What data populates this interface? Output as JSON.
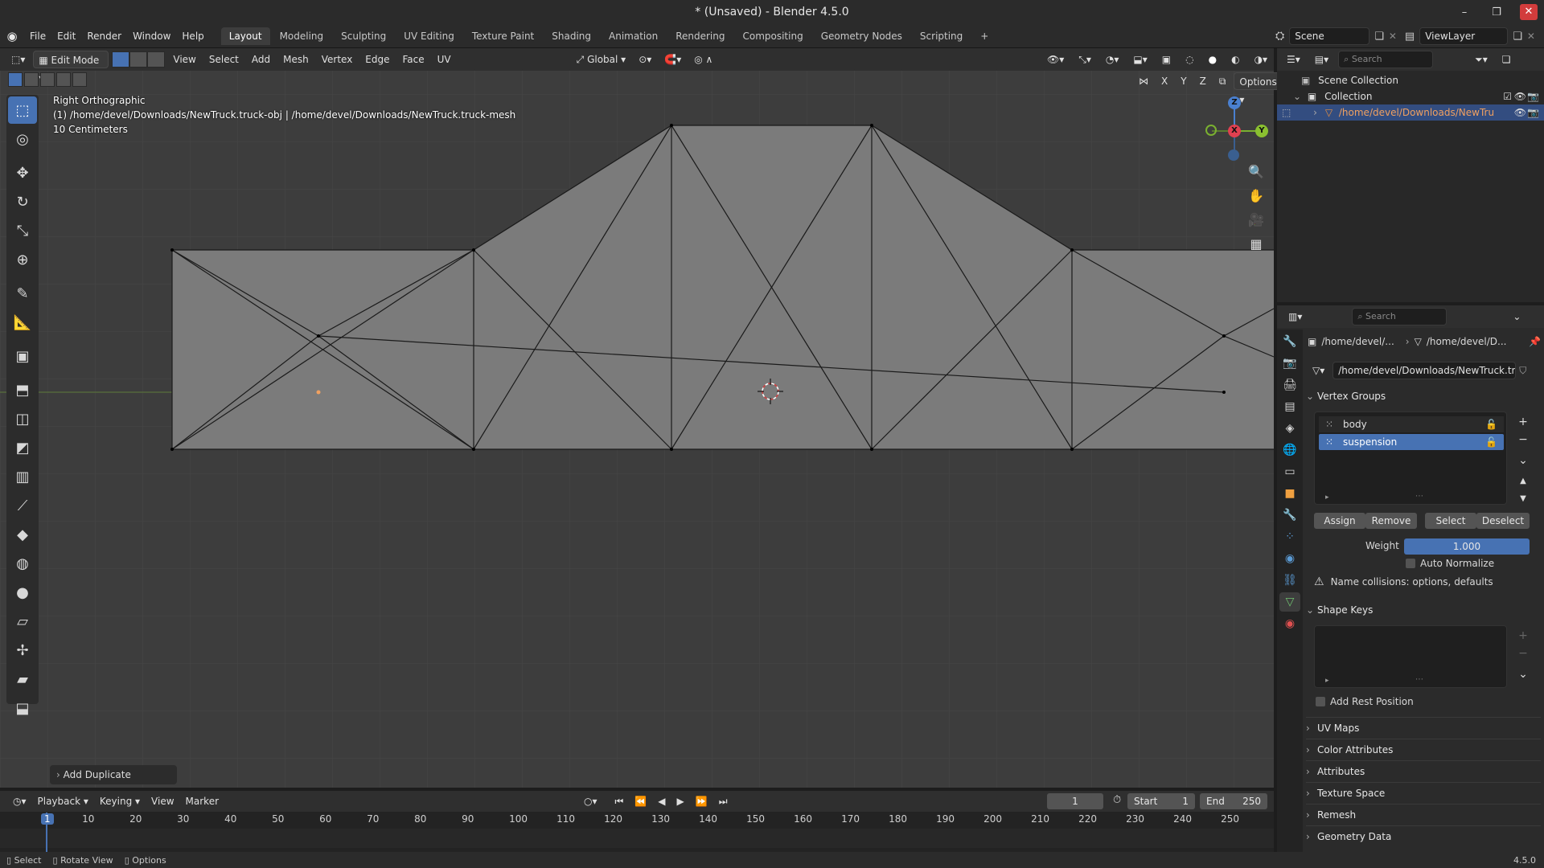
{
  "window": {
    "title": "* (Unsaved) - Blender 4.5.0",
    "buttons": [
      "–",
      "❐",
      "✕"
    ]
  },
  "menubar": {
    "items": [
      "File",
      "Edit",
      "Render",
      "Window",
      "Help"
    ],
    "workspaces": [
      "Layout",
      "Modeling",
      "Sculpting",
      "UV Editing",
      "Texture Paint",
      "Shading",
      "Animation",
      "Rendering",
      "Compositing",
      "Geometry Nodes",
      "Scripting"
    ],
    "active_workspace": "Layout",
    "add_tab": "+",
    "scene": "Scene",
    "view_layer": "ViewLayer"
  },
  "viewport_header": {
    "mode": "Edit Mode",
    "menus": [
      "View",
      "Select",
      "Add",
      "Mesh",
      "Vertex",
      "Edge",
      "Face",
      "UV"
    ],
    "orientation": "Global",
    "axes": [
      "X",
      "Y",
      "Z"
    ],
    "options": "Options"
  },
  "viewport_info": {
    "view_name": "Right Orthographic",
    "object_path": "(1) /home/devel/Downloads/NewTruck.truck-obj | /home/devel/Downloads/NewTruck.truck-mesh",
    "scale": "10 Centimeters"
  },
  "gizmo": {
    "x": "X",
    "y": "Y",
    "z": "Z"
  },
  "operator_panel": {
    "label": "Add Duplicate"
  },
  "outliner": {
    "search_placeholder": "Search",
    "scene_collection": "Scene Collection",
    "collection": "Collection",
    "object": "/home/devel/Downloads/NewTru"
  },
  "properties": {
    "search_placeholder": "Search",
    "breadcrumb_object": "/home/devel/...",
    "breadcrumb_mesh": "/home/devel/D...",
    "mesh_name": "/home/devel/Downloads/NewTruck.truc...",
    "vertex_groups": {
      "title": "Vertex Groups",
      "items": [
        "body",
        "suspension"
      ],
      "selected": "suspension",
      "buttons": [
        "Assign",
        "Remove",
        "Select",
        "Deselect"
      ],
      "weight_label": "Weight",
      "weight_value": "1.000",
      "auto_normalize": "Auto Normalize",
      "warning": "Name collisions: options, defaults"
    },
    "shape_keys": {
      "title": "Shape Keys",
      "add_rest_position": "Add Rest Position"
    },
    "collapsed_panels": [
      "UV Maps",
      "Color Attributes",
      "Attributes",
      "Texture Space",
      "Remesh",
      "Geometry Data"
    ]
  },
  "timeline": {
    "menus": [
      "Playback",
      "Keying",
      "View",
      "Marker"
    ],
    "current_frame": "1",
    "start_label": "Start",
    "start_value": "1",
    "end_label": "End",
    "end_value": "250",
    "ticks": [
      "1",
      "10",
      "20",
      "30",
      "40",
      "50",
      "60",
      "70",
      "80",
      "90",
      "100",
      "110",
      "120",
      "130",
      "140",
      "150",
      "160",
      "170",
      "180",
      "190",
      "200",
      "210",
      "220",
      "230",
      "240",
      "250"
    ]
  },
  "statusbar": {
    "hints": [
      "Select",
      "Rotate View",
      "Options"
    ],
    "version": "4.5.0"
  }
}
